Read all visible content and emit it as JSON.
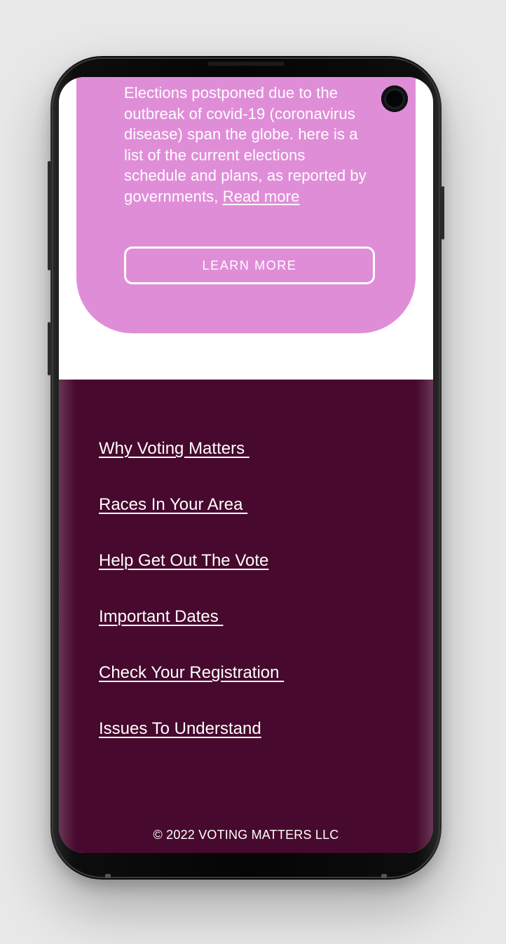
{
  "promo": {
    "body_text": "Elections postponed due to the outbreak of covid-19 (coronavirus disease) span the globe. here is a list of the current elections schedule and plans, as reported by governments, ",
    "read_more_label": "Read more",
    "button_label": "LEARN MORE"
  },
  "footer": {
    "links": [
      {
        "label": "Why Voting Matters "
      },
      {
        "label": "Races In Your Area "
      },
      {
        "label": "Help Get Out The Vote"
      },
      {
        "label": "Important Dates "
      },
      {
        "label": "Check Your Registration "
      },
      {
        "label": "Issues To Understand"
      }
    ],
    "copyright": "© 2022 VOTING MATTERS LLC"
  },
  "colors": {
    "background": "#e8e8e8",
    "promo_card": "#e08dd8",
    "footer": "#47092d",
    "text": "#ffffff"
  },
  "icons": {
    "camera": "front-camera-icon"
  }
}
